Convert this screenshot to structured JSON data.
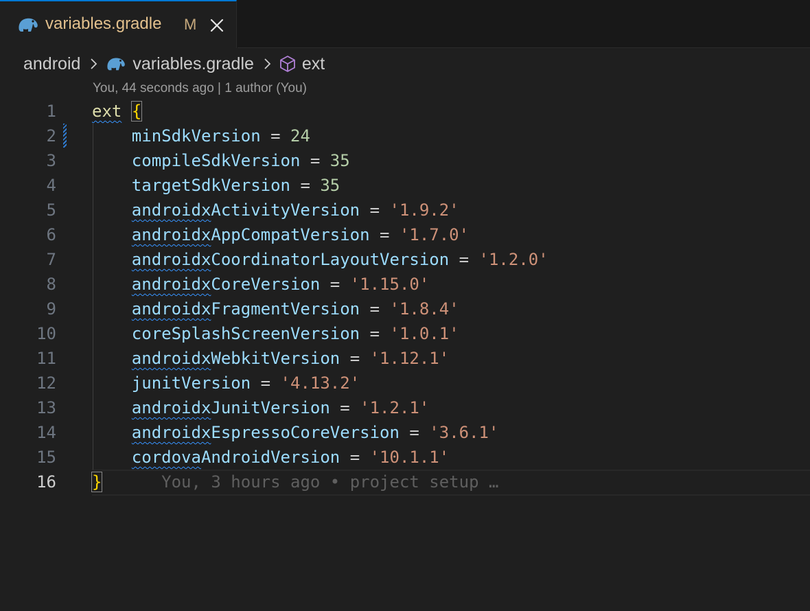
{
  "tab": {
    "filename": "variables.gradle",
    "badge": "M",
    "icon": "gradle-elephant-icon",
    "close_icon": "close-icon"
  },
  "breadcrumb": {
    "folder": "android",
    "file": "variables.gradle",
    "symbol": "ext",
    "symbol_icon": "cube-icon"
  },
  "blame_header": "You, 44 seconds ago | 1 author (You)",
  "colors": {
    "tab_accent": "#0078d4",
    "modified": "#e2c08d",
    "keyword": "#dcdcaa",
    "variable": "#9cdcfe",
    "number": "#b5cea8",
    "string": "#ce9178",
    "brace": "#ffd700",
    "squiggle": "#3794ff",
    "symbol_icon": "#b180d7"
  },
  "code": {
    "line_numbers": [
      "1",
      "2",
      "3",
      "4",
      "5",
      "6",
      "7",
      "8",
      "9",
      "10",
      "11",
      "12",
      "13",
      "14",
      "15",
      "16"
    ],
    "open": {
      "keyword": "ext",
      "brace": "{"
    },
    "entries": [
      {
        "name": "minSdkVersion",
        "op": "=",
        "value": "24",
        "kind": "num",
        "squiggle": ""
      },
      {
        "name": "compileSdkVersion",
        "op": "=",
        "value": "35",
        "kind": "num",
        "squiggle": ""
      },
      {
        "name": "targetSdkVersion",
        "op": "=",
        "value": "35",
        "kind": "num",
        "squiggle": ""
      },
      {
        "name": "androidxActivityVersion",
        "op": "=",
        "value": "'1.9.2'",
        "kind": "str",
        "squiggle": "androidx"
      },
      {
        "name": "androidxAppCompatVersion",
        "op": "=",
        "value": "'1.7.0'",
        "kind": "str",
        "squiggle": "androidx"
      },
      {
        "name": "androidxCoordinatorLayoutVersion",
        "op": "=",
        "value": "'1.2.0'",
        "kind": "str",
        "squiggle": "androidx"
      },
      {
        "name": "androidxCoreVersion",
        "op": "=",
        "value": "'1.15.0'",
        "kind": "str",
        "squiggle": "androidx"
      },
      {
        "name": "androidxFragmentVersion",
        "op": "=",
        "value": "'1.8.4'",
        "kind": "str",
        "squiggle": "androidx"
      },
      {
        "name": "coreSplashScreenVersion",
        "op": "=",
        "value": "'1.0.1'",
        "kind": "str",
        "squiggle": ""
      },
      {
        "name": "androidxWebkitVersion",
        "op": "=",
        "value": "'1.12.1'",
        "kind": "str",
        "squiggle": "androidx"
      },
      {
        "name": "junitVersion",
        "op": "=",
        "value": "'4.13.2'",
        "kind": "str",
        "squiggle": ""
      },
      {
        "name": "androidxJunitVersion",
        "op": "=",
        "value": "'1.2.1'",
        "kind": "str",
        "squiggle": "androidx"
      },
      {
        "name": "androidxEspressoCoreVersion",
        "op": "=",
        "value": "'3.6.1'",
        "kind": "str",
        "squiggle": "androidx"
      },
      {
        "name": "cordovaAndroidVersion",
        "op": "=",
        "value": "'10.1.1'",
        "kind": "str",
        "squiggle": "cordova"
      }
    ],
    "close": {
      "brace": "}"
    },
    "inline_blame": "You, 3 hours ago • project setup …",
    "current_line": "16"
  }
}
